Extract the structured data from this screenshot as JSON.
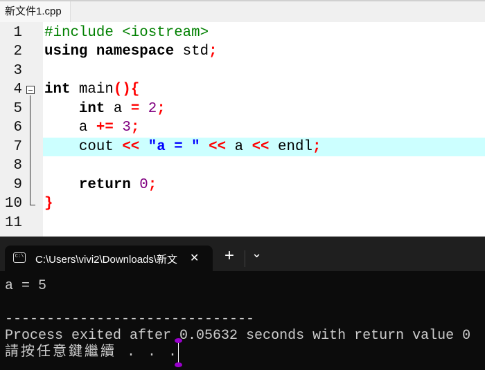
{
  "editor_tab": {
    "label": "新文件1.cpp"
  },
  "colors": {
    "keyword": "#000000",
    "preprocessor": "#008000",
    "symbol": "#ff0000",
    "number": "#800080",
    "string": "#0000ff",
    "identifier": "#000000",
    "highlight": "#ccffff"
  },
  "code_lines": [
    {
      "num": "1",
      "tokens": [
        {
          "t": "#include <iostream>",
          "c": "preprocessor"
        }
      ]
    },
    {
      "num": "2",
      "tokens": [
        {
          "t": "using namespace",
          "c": "keyword"
        },
        {
          "t": " std",
          "c": "identifier"
        },
        {
          "t": ";",
          "c": "symbol"
        }
      ]
    },
    {
      "num": "3",
      "tokens": []
    },
    {
      "num": "4",
      "tokens": [
        {
          "t": "int",
          "c": "keyword"
        },
        {
          "t": " main",
          "c": "identifier"
        },
        {
          "t": "(){",
          "c": "symbol"
        }
      ]
    },
    {
      "num": "5",
      "tokens": [
        {
          "t": "    ",
          "c": "identifier"
        },
        {
          "t": "int",
          "c": "keyword"
        },
        {
          "t": " a ",
          "c": "identifier"
        },
        {
          "t": "=",
          "c": "symbol"
        },
        {
          "t": " ",
          "c": "identifier"
        },
        {
          "t": "2",
          "c": "number"
        },
        {
          "t": ";",
          "c": "symbol"
        }
      ]
    },
    {
      "num": "6",
      "tokens": [
        {
          "t": "    a ",
          "c": "identifier"
        },
        {
          "t": "+=",
          "c": "symbol"
        },
        {
          "t": " ",
          "c": "identifier"
        },
        {
          "t": "3",
          "c": "number"
        },
        {
          "t": ";",
          "c": "symbol"
        }
      ]
    },
    {
      "num": "7",
      "highlight": true,
      "tokens": [
        {
          "t": "    cout ",
          "c": "identifier"
        },
        {
          "t": "<<",
          "c": "symbol"
        },
        {
          "t": " ",
          "c": "identifier"
        },
        {
          "t": "\"a = \"",
          "c": "string"
        },
        {
          "t": " ",
          "c": "identifier"
        },
        {
          "t": "<<",
          "c": "symbol"
        },
        {
          "t": " a ",
          "c": "identifier"
        },
        {
          "t": "<<",
          "c": "symbol"
        },
        {
          "t": " endl",
          "c": "identifier"
        },
        {
          "t": ";",
          "c": "symbol"
        }
      ]
    },
    {
      "num": "8",
      "tokens": []
    },
    {
      "num": "9",
      "tokens": [
        {
          "t": "    ",
          "c": "identifier"
        },
        {
          "t": "return",
          "c": "keyword"
        },
        {
          "t": " ",
          "c": "identifier"
        },
        {
          "t": "0",
          "c": "number"
        },
        {
          "t": ";",
          "c": "symbol"
        }
      ]
    },
    {
      "num": "10",
      "tokens": [
        {
          "t": "}",
          "c": "symbol"
        }
      ]
    },
    {
      "num": "11",
      "tokens": []
    }
  ],
  "terminal": {
    "tab_title": "C:\\Users\\vivi2\\Downloads\\新文",
    "new_tab": "+",
    "dropdown": "⌄",
    "close": "✕",
    "output_lines": [
      "a = 5",
      "",
      "------------------------------",
      "Process exited after 0.05632 seconds with return value 0",
      "請按任意鍵繼續 . . ."
    ]
  }
}
